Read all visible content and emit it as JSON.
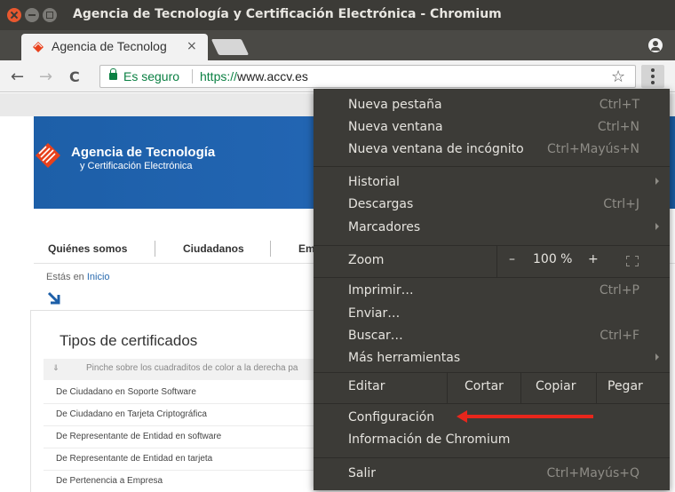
{
  "window": {
    "title": "Agencia de Tecnología y Certificación Electrónica - Chromium"
  },
  "tab": {
    "title": "Agencia de Tecnolog",
    "close_glyph": "×"
  },
  "toolbar": {
    "back_glyph": "←",
    "forward_glyph": "→",
    "reload_glyph": "C",
    "secure_label": "Es seguro",
    "url_scheme": "https://",
    "url_host": "www.accv.es",
    "star_glyph": "☆"
  },
  "page": {
    "brand_name": "Agencia de Tecnología",
    "brand_sub": "y Certificación Electrónica",
    "nav": [
      "Quiénes somos",
      "Ciudadanos",
      "Em"
    ],
    "breadcrumb_prefix": "Estás en",
    "breadcrumb_link": "Inicio",
    "cert_title": "Tipos de certificados",
    "cert_hint": "Pinche sobre los cuadraditos de color a la derecha pa",
    "cert_rows": [
      "De Ciudadano en Soporte Software",
      "De Ciudadano en Tarjeta Criptográfica",
      "De Representante de Entidad en software",
      "De Representante de Entidad en tarjeta",
      "De Pertenencia a Empresa"
    ]
  },
  "menu": {
    "items": [
      {
        "label": "Nueva pestaña",
        "shortcut": "Ctrl+T"
      },
      {
        "label": "Nueva ventana",
        "shortcut": "Ctrl+N"
      },
      {
        "label": "Nueva ventana de incógnito",
        "shortcut": "Ctrl+Mayús+N"
      },
      {
        "label": "Historial",
        "shortcut": ""
      },
      {
        "label": "Descargas",
        "shortcut": "Ctrl+J"
      },
      {
        "label": "Marcadores",
        "shortcut": ""
      },
      {
        "label": "Imprimir…",
        "shortcut": "Ctrl+P"
      },
      {
        "label": "Enviar…",
        "shortcut": ""
      },
      {
        "label": "Buscar…",
        "shortcut": "Ctrl+F"
      },
      {
        "label": "Más herramientas",
        "shortcut": ""
      },
      {
        "label": "Configuración",
        "shortcut": ""
      },
      {
        "label": "Información de Chromium",
        "shortcut": ""
      },
      {
        "label": "Salir",
        "shortcut": "Ctrl+Mayús+Q"
      }
    ],
    "zoom": {
      "label": "Zoom",
      "minus": "–",
      "value": "100 %",
      "plus": "+"
    },
    "edit": {
      "label": "Editar",
      "cut": "Cortar",
      "copy": "Copiar",
      "paste": "Pegar"
    }
  },
  "colors": {
    "menu_bg": "#3c3b37",
    "accent_red": "#e8261c",
    "secure_green": "#0b8043",
    "banner_blue": "#1d5fa8"
  }
}
